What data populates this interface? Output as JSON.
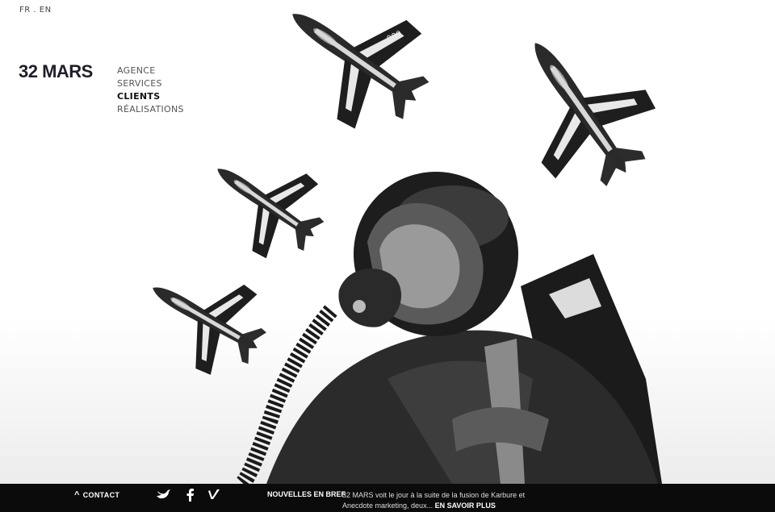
{
  "lang": {
    "fr": "FR",
    "sep": " . ",
    "en": "EN"
  },
  "logo": "32 MARS",
  "nav": [
    "AGENCE",
    "SERVICES",
    "CLIENTS",
    "RÉALISATIONS"
  ],
  "active_nav": "CLIENTS",
  "footer": {
    "contact": "CONTACT",
    "news_title": "NOUVELLES EN BREF",
    "news_text": "32 MARS voit le jour à la suite de la fusion de Karbure et Anecdote marketing, deux...",
    "news_more": "EN SAVOIR PLUS"
  },
  "plane_marking": "009",
  "icons": [
    "twitter-icon",
    "facebook-icon",
    "vimeo-icon"
  ]
}
